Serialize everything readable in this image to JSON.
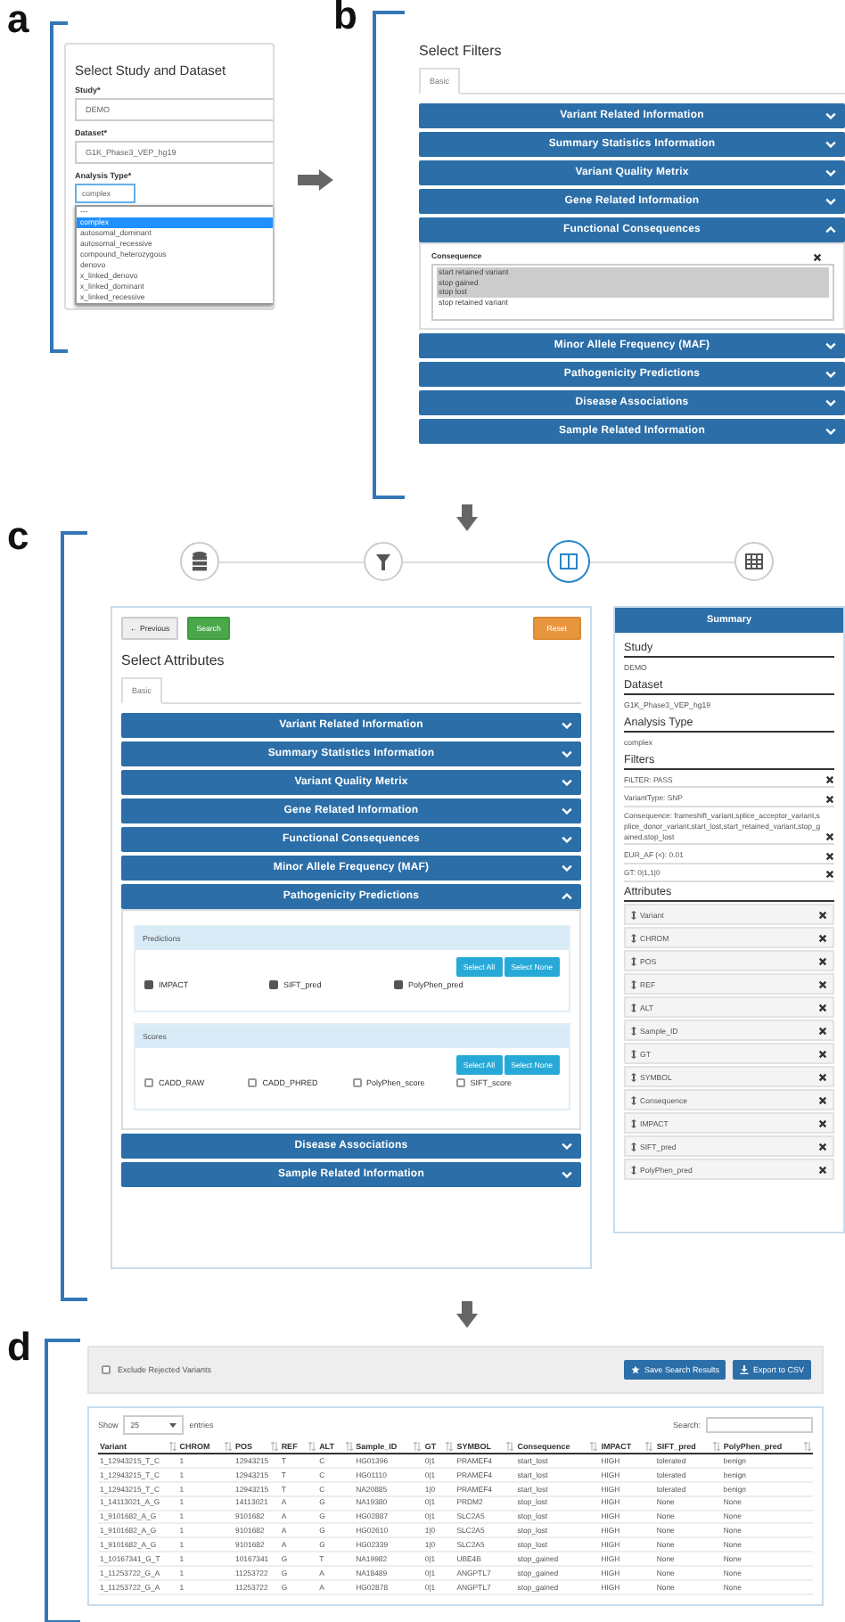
{
  "panel_a": {
    "label": "a",
    "title": "Select Study and Dataset",
    "fields": [
      {
        "label": "Study*",
        "value": "DEMO"
      },
      {
        "label": "Dataset*",
        "value": "G1K_Phase3_VEP_hg19"
      },
      {
        "label": "Analysis Type*",
        "value": "complex"
      }
    ],
    "dropdown_options": [
      {
        "text": "---",
        "selected": false
      },
      {
        "text": "complex",
        "selected": true
      },
      {
        "text": "autosomal_dominant",
        "selected": false
      },
      {
        "text": "autosomal_recessive",
        "selected": false
      },
      {
        "text": "compound_heterozygous",
        "selected": false
      },
      {
        "text": "denovo",
        "selected": false
      },
      {
        "text": "x_linked_denovo",
        "selected": false
      },
      {
        "text": "x_linked_dominant",
        "selected": false
      },
      {
        "text": "x_linked_recessive",
        "selected": false
      }
    ]
  },
  "panel_b": {
    "label": "b",
    "title": "Select Filters",
    "tabs": [
      {
        "label": "Basic",
        "selected": true
      }
    ],
    "sections": [
      {
        "title": "Variant Related Information",
        "expanded": false
      },
      {
        "title": "Summary Statistics Information",
        "expanded": false
      },
      {
        "title": "Variant Quality Metrix",
        "expanded": false
      },
      {
        "title": "Gene Related Information",
        "expanded": false
      },
      {
        "title": "Functional Consequences",
        "expanded": true,
        "field_label": "Consequence",
        "options": [
          {
            "text": "start retained variant",
            "selected": true
          },
          {
            "text": "stop gained",
            "selected": true
          },
          {
            "text": "stop lost",
            "selected": true
          },
          {
            "text": "stop retained variant",
            "selected": false
          }
        ]
      },
      {
        "title": "Minor Allele Frequency (MAF)",
        "expanded": false
      },
      {
        "title": "Pathogenicity Predictions",
        "expanded": false
      },
      {
        "title": "Disease Associations",
        "expanded": false
      },
      {
        "title": "Sample Related Information",
        "expanded": false
      }
    ]
  },
  "panel_c": {
    "label": "c",
    "steps": [
      {
        "kind": "database",
        "selected": false
      },
      {
        "kind": "filter",
        "selected": false
      },
      {
        "kind": "columns",
        "selected": true
      },
      {
        "kind": "table",
        "selected": false
      }
    ],
    "buttons": [
      {
        "text": "← Previous",
        "kind": "default"
      },
      {
        "text": "Search",
        "kind": "success"
      },
      {
        "text": "Reset",
        "kind": "warning"
      }
    ],
    "title": "Select Attributes",
    "tabs": [
      {
        "label": "Basic",
        "selected": true
      }
    ],
    "sections": [
      {
        "title": "Variant Related Information",
        "expanded": false
      },
      {
        "title": "Summary Statistics Information",
        "expanded": false
      },
      {
        "title": "Variant Quality Metrix",
        "expanded": false
      },
      {
        "title": "Gene Related Information",
        "expanded": false
      },
      {
        "title": "Functional Consequences",
        "expanded": false
      },
      {
        "title": "Minor Allele Frequency (MAF)",
        "expanded": false
      },
      {
        "title": "Pathogenicity Predictions",
        "expanded": true,
        "groups": [
          {
            "title": "Predictions",
            "buttons": [
              "Select All",
              "Select None"
            ],
            "items": [
              {
                "label": "IMPACT",
                "checked": true
              },
              {
                "label": "SIFT_pred",
                "checked": true
              },
              {
                "label": "PolyPhen_pred",
                "checked": true
              }
            ]
          },
          {
            "title": "Scores",
            "buttons": [
              "Select All",
              "Select None"
            ],
            "items": [
              {
                "label": "CADD_RAW",
                "checked": false
              },
              {
                "label": "CADD_PHRED",
                "checked": false
              },
              {
                "label": "PolyPhen_score",
                "checked": false
              },
              {
                "label": "SIFT_score",
                "checked": false
              }
            ]
          }
        ]
      },
      {
        "title": "Disease Associations",
        "expanded": false
      },
      {
        "title": "Sample Related Information",
        "expanded": false
      }
    ],
    "summary": {
      "title": "Summary",
      "sections": [
        {
          "heading": "Study",
          "items": [
            {
              "text": "DEMO",
              "kind": "plain"
            }
          ]
        },
        {
          "heading": "Dataset",
          "items": [
            {
              "text": "G1K_Phase3_VEP_hg19",
              "kind": "plain"
            }
          ]
        },
        {
          "heading": "Analysis Type",
          "items": [
            {
              "text": "complex",
              "kind": "plain"
            }
          ]
        },
        {
          "heading": "Filters",
          "items": [
            {
              "text": "FILTER: PASS",
              "kind": "filter"
            },
            {
              "text": "VariantType: SNP",
              "kind": "filter"
            },
            {
              "text": "Consequence: frameshift_variant,splice_acceptor_variant,splice_donor_variant,start_lost,start_retained_variant,stop_gained,stop_lost",
              "kind": "filter"
            },
            {
              "text": "EUR_AF (<): 0.01",
              "kind": "filter"
            },
            {
              "text": "GT: 0|1,1|0",
              "kind": "filter"
            }
          ]
        },
        {
          "heading": "Attributes",
          "items": [
            {
              "text": "Variant",
              "kind": "attribute"
            },
            {
              "text": "CHROM",
              "kind": "attribute"
            },
            {
              "text": "POS",
              "kind": "attribute"
            },
            {
              "text": "REF",
              "kind": "attribute"
            },
            {
              "text": "ALT",
              "kind": "attribute"
            },
            {
              "text": "Sample_ID",
              "kind": "attribute"
            },
            {
              "text": "GT",
              "kind": "attribute"
            },
            {
              "text": "SYMBOL",
              "kind": "attribute"
            },
            {
              "text": "Consequence",
              "kind": "attribute"
            },
            {
              "text": "IMPACT",
              "kind": "attribute"
            },
            {
              "text": "SIFT_pred",
              "kind": "attribute"
            },
            {
              "text": "PolyPhen_pred",
              "kind": "attribute"
            }
          ]
        }
      ]
    }
  },
  "panel_d": {
    "label": "d",
    "exclude": {
      "label": "Exclude Rejected Variants",
      "checked": false
    },
    "buttons": [
      {
        "text": "Save Search Results",
        "kind": "star"
      },
      {
        "text": "Export to CSV",
        "kind": "download"
      }
    ],
    "show_label": "Show",
    "page_size": "25",
    "entries_label": "entries",
    "search_label": "Search:",
    "table": {
      "columns": [
        "Variant",
        "CHROM",
        "POS",
        "REF",
        "ALT",
        "Sample_ID",
        "GT",
        "SYMBOL",
        "Consequence",
        "IMPACT",
        "SIFT_pred",
        "PolyPhen_pred"
      ],
      "rows": [
        [
          "1_12943215_T_C",
          "1",
          "12943215",
          "T",
          "C",
          "HG01396",
          "0|1",
          "PRAMEF4",
          "start_lost",
          "HIGH",
          "tolerated",
          "benign"
        ],
        [
          "1_12943215_T_C",
          "1",
          "12943215",
          "T",
          "C",
          "HG01110",
          "0|1",
          "PRAMEF4",
          "start_lost",
          "HIGH",
          "tolerated",
          "benign"
        ],
        [
          "1_12943215_T_C",
          "1",
          "12943215",
          "T",
          "C",
          "NA20885",
          "1|0",
          "PRAMEF4",
          "start_lost",
          "HIGH",
          "tolerated",
          "benign"
        ],
        [
          "1_14113021_A_G",
          "1",
          "14113021",
          "A",
          "G",
          "NA19380",
          "0|1",
          "PRDM2",
          "stop_lost",
          "HIGH",
          "None",
          "None"
        ],
        [
          "1_9101682_A_G",
          "1",
          "9101682",
          "A",
          "G",
          "HG02887",
          "0|1",
          "SLC2A5",
          "stop_lost",
          "HIGH",
          "None",
          "None"
        ],
        [
          "1_9101682_A_G",
          "1",
          "9101682",
          "A",
          "G",
          "HG02610",
          "1|0",
          "SLC2A5",
          "stop_lost",
          "HIGH",
          "None",
          "None"
        ],
        [
          "1_9101682_A_G",
          "1",
          "9101682",
          "A",
          "G",
          "HG02339",
          "1|0",
          "SLC2A5",
          "stop_lost",
          "HIGH",
          "None",
          "None"
        ],
        [
          "1_10167341_G_T",
          "1",
          "10167341",
          "G",
          "T",
          "NA19982",
          "0|1",
          "UBE4B",
          "stop_gained",
          "HIGH",
          "None",
          "None"
        ],
        [
          "1_11253722_G_A",
          "1",
          "11253722",
          "G",
          "A",
          "NA18489",
          "0|1",
          "ANGPTL7",
          "stop_gained",
          "HIGH",
          "None",
          "None"
        ],
        [
          "1_11253722_G_A",
          "1",
          "11253722",
          "G",
          "A",
          "HG02878",
          "0|1",
          "ANGPTL7",
          "stop_gained",
          "HIGH",
          "None",
          "None"
        ]
      ]
    }
  }
}
